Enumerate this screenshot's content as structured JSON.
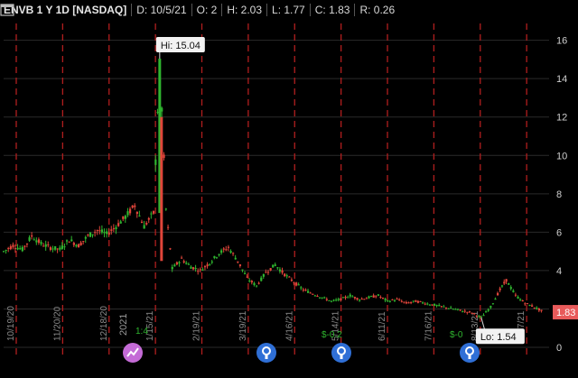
{
  "header": {
    "symbol": "ENVB 1 Y 1D [NASDAQ]",
    "date": "D: 10/5/21",
    "open": "O: 2",
    "high": "H: 2.03",
    "low": "L: 1.77",
    "close": "C: 1.83",
    "range": "R: 0.26"
  },
  "settings_icon": "settings-icon",
  "callouts": {
    "hi": "Hi: 15.04",
    "lo": "Lo: 1.54",
    "last_price": "1.83"
  },
  "colors": {
    "up": "#2fb52f",
    "down": "#e0453a",
    "grid": "#b01e1e",
    "axis_text": "#cfcfcf",
    "price_badge": "#e85a5a",
    "event_icon": "#2f6fd6",
    "split_icon": "#c46bd6"
  },
  "chart_data": {
    "type": "candlestick",
    "ylim": [
      0,
      16.5
    ],
    "y_ticks": [
      "0",
      "2",
      "4",
      "6",
      "8",
      "10",
      "12",
      "14",
      "16"
    ],
    "x_ticks": [
      "10/19/20",
      "11/20/20",
      "12/18/20",
      "1/15/21",
      "2/19/21",
      "3/19/21",
      "4/16/21",
      "5/14/21",
      "6/11/21",
      "7/16/21",
      "8/13/21",
      "9/17/21"
    ],
    "year_marker": "2021",
    "price_points": [
      [
        0,
        5.0
      ],
      [
        6,
        5.3
      ],
      [
        12,
        5.1
      ],
      [
        18,
        5.8
      ],
      [
        24,
        5.4
      ],
      [
        30,
        5.2
      ],
      [
        36,
        5.1
      ],
      [
        42,
        5.6
      ],
      [
        48,
        5.3
      ],
      [
        54,
        5.8
      ],
      [
        60,
        6.1
      ],
      [
        66,
        5.9
      ],
      [
        72,
        6.3
      ],
      [
        78,
        6.8
      ],
      [
        84,
        7.4
      ],
      [
        90,
        6.3
      ],
      [
        96,
        7.0
      ],
      [
        100,
        15.04
      ],
      [
        104,
        7.2
      ],
      [
        108,
        4.1
      ],
      [
        114,
        4.6
      ],
      [
        120,
        4.2
      ],
      [
        126,
        4.0
      ],
      [
        132,
        4.4
      ],
      [
        138,
        4.9
      ],
      [
        144,
        5.2
      ],
      [
        150,
        4.5
      ],
      [
        156,
        3.6
      ],
      [
        162,
        3.2
      ],
      [
        168,
        3.9
      ],
      [
        174,
        4.3
      ],
      [
        180,
        3.8
      ],
      [
        186,
        3.4
      ],
      [
        192,
        3.0
      ],
      [
        198,
        2.8
      ],
      [
        204,
        2.6
      ],
      [
        210,
        2.4
      ],
      [
        216,
        2.5
      ],
      [
        222,
        2.7
      ],
      [
        228,
        2.5
      ],
      [
        234,
        2.6
      ],
      [
        240,
        2.7
      ],
      [
        246,
        2.4
      ],
      [
        252,
        2.5
      ],
      [
        258,
        2.3
      ],
      [
        264,
        2.4
      ],
      [
        270,
        2.3
      ],
      [
        276,
        2.2
      ],
      [
        282,
        2.1
      ],
      [
        288,
        2.0
      ],
      [
        294,
        1.9
      ],
      [
        300,
        1.8
      ],
      [
        306,
        1.54
      ],
      [
        312,
        2.1
      ],
      [
        318,
        3.0
      ],
      [
        322,
        3.5
      ],
      [
        328,
        2.7
      ],
      [
        334,
        2.3
      ],
      [
        340,
        2.1
      ],
      [
        346,
        1.83
      ]
    ],
    "hi_value": 15.04,
    "lo_value": 1.54,
    "last_value": 1.83,
    "events": [
      {
        "type": "split",
        "label": "1:4"
      },
      {
        "type": "earnings",
        "label": ""
      },
      {
        "type": "earnings",
        "label": "$-0.2"
      },
      {
        "type": "earnings",
        "label": "$-0"
      }
    ]
  }
}
